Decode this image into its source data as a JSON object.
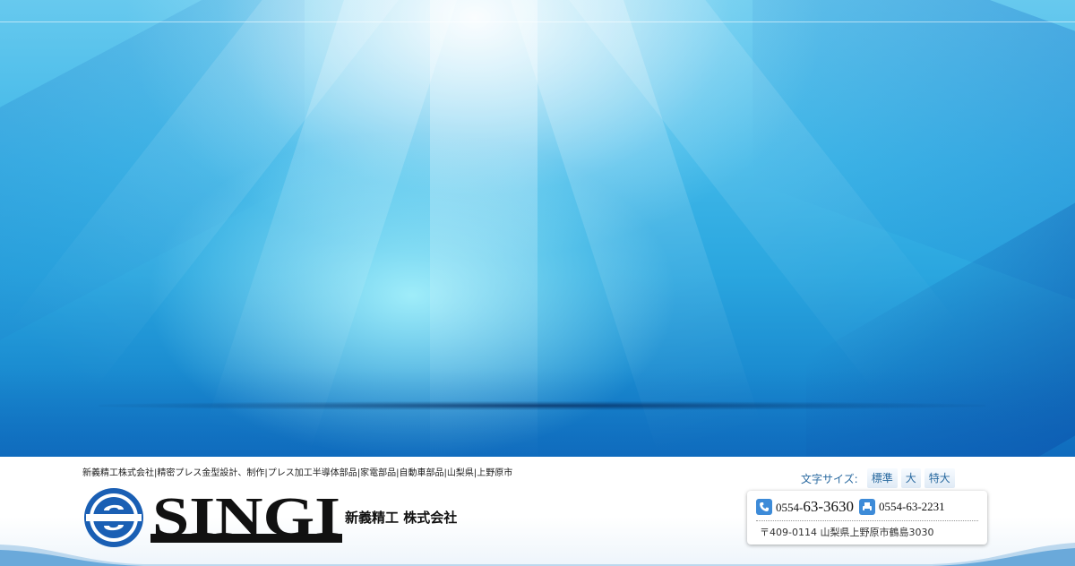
{
  "header": {
    "tagline": "新義精工株式会社|精密プレス金型設計、制作|プレス加工半導体部品|家電部品|自動車部品|山梨県|上野原市",
    "company_name": "新義精工 株式会社",
    "logo_text": "SINGI"
  },
  "font_size": {
    "label": "文字サイズ:",
    "options": [
      "標準",
      "大",
      "特大"
    ]
  },
  "contact": {
    "tel_prefix": "0554-",
    "tel_rest": "63-3630",
    "fax": "0554-63-2231",
    "address": "〒409-0114 山梨県上野原市鶴島3030",
    "tel_icon": "phone-icon",
    "fax_icon": "fax-icon"
  },
  "colors": {
    "brand_blue": "#1a5fb4",
    "logo_black": "#111111"
  }
}
